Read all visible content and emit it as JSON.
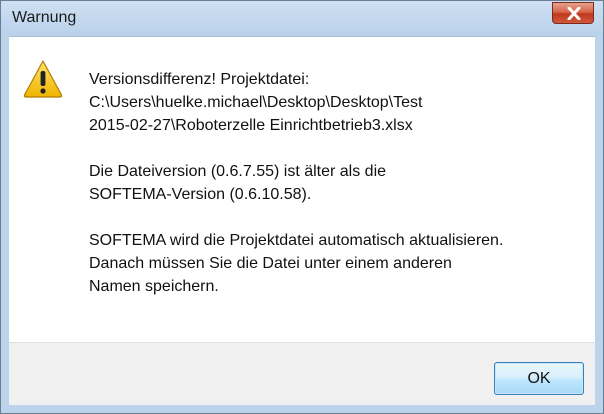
{
  "window": {
    "title": "Warnung",
    "close_icon": "close-icon"
  },
  "dialog": {
    "icon": "warning-icon",
    "paragraphs": [
      {
        "lines": [
          "Versionsdifferenz! Projektdatei:",
          "C:\\Users\\huelke.michael\\Desktop\\Desktop\\Test",
          "2015-02-27\\Roboterzelle Einrichtbetrieb3.xlsx"
        ]
      },
      {
        "lines": [
          "Die Dateiversion (0.6.7.55) ist älter als die",
          "SOFTEMA-Version (0.6.10.58)."
        ]
      },
      {
        "lines": [
          "SOFTEMA wird die Projektdatei automatisch aktualisieren.",
          "Danach müssen Sie die Datei unter einem anderen",
          "Namen speichern."
        ]
      }
    ]
  },
  "footer": {
    "ok_label": "OK"
  },
  "colors": {
    "frame": "#bcd3ec",
    "close_button": "#c0391f",
    "warning_yellow": "#f4c20d",
    "footer_bg": "#f0f0f0"
  }
}
